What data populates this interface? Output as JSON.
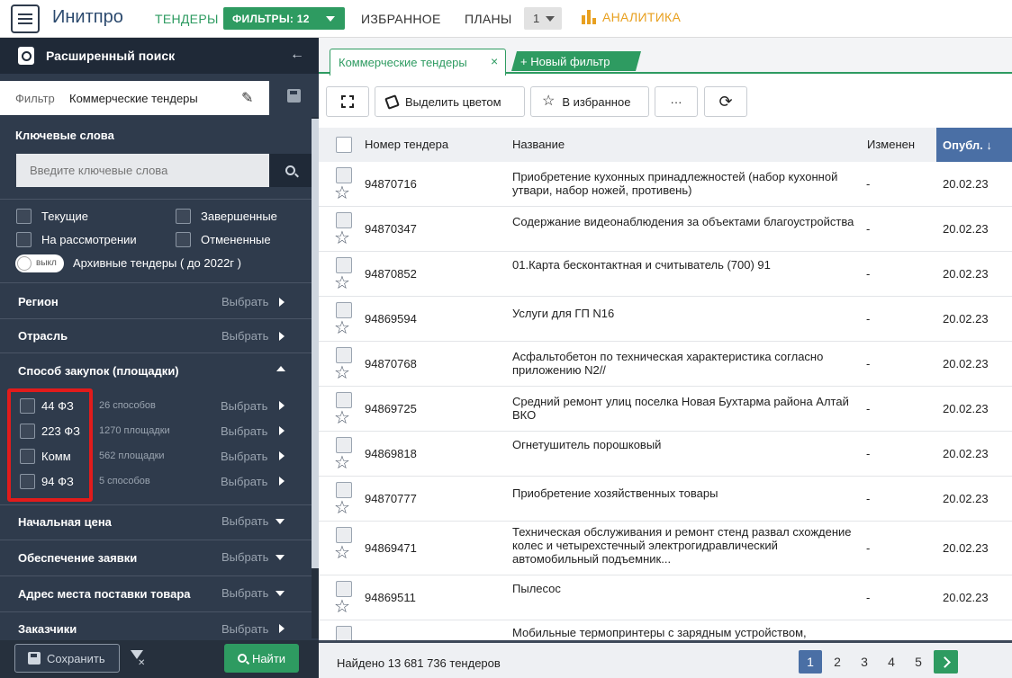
{
  "topbar": {
    "logo": "Инитпро",
    "tenders": "ТЕНДЕРЫ",
    "filters": "ФИЛЬТРЫ: 12",
    "favorites": "ИЗБРАННОЕ",
    "plans": "ПЛАНЫ",
    "plans_count": "1",
    "analytics": "АНАЛИТИКА",
    "accent_color": "#2e9b61",
    "analytics_color": "#e8a020"
  },
  "sidebar": {
    "title": "Расширенный поиск",
    "filter_label": "Фильтр",
    "filter_name": "Коммерческие тендеры",
    "keywords_label": "Ключевые слова",
    "keywords_placeholder": "Введите ключевые слова",
    "status": {
      "current": "Текущие",
      "finished": "Завершенные",
      "review": "На рассмотрении",
      "cancelled": "Отмененные"
    },
    "archive_toggle": "выкл",
    "archive_label": "Архивные тендеры ( до 2022г )",
    "choose": "Выбрать",
    "sections": {
      "region": "Регион",
      "industry": "Отрасль",
      "procurement": "Способ закупок (площадки)",
      "start_price": "Начальная цена",
      "security": "Обеспечение заявки",
      "address": "Адрес места поставки товара",
      "customers": "Заказчики"
    },
    "laws": [
      {
        "label": "44 ФЗ",
        "count": "26 способов"
      },
      {
        "label": "223 ФЗ",
        "count": "1270 площадки"
      },
      {
        "label": "Комм",
        "count": "562 площадки"
      },
      {
        "label": "94 ФЗ",
        "count": "5 способов"
      }
    ],
    "save": "Сохранить",
    "find": "Найти"
  },
  "tabs": {
    "active": "Коммерческие тендеры",
    "close": "×",
    "new": "+ Новый фильтр"
  },
  "toolbar": {
    "highlight": "Выделить цветом",
    "favorite": "В избранное",
    "more": "···"
  },
  "table": {
    "headers": {
      "number": "Номер тендера",
      "name": "Название",
      "changed": "Изменен",
      "published": "Опубл. ↓"
    },
    "rows": [
      {
        "num": "94870716",
        "name": "Приобретение кухонных принадлежностей (набор кухонной утвари, набор ножей, противень)",
        "changed": "-",
        "pub": "20.02.23"
      },
      {
        "num": "94870347",
        "name": "Содержание видеонаблюдения за объектами благоустройства",
        "changed": "-",
        "pub": "20.02.23"
      },
      {
        "num": "94870852",
        "name": "01.Карта бесконтактная и считыватель (700) 91",
        "changed": "-",
        "pub": "20.02.23"
      },
      {
        "num": "94869594",
        "name": "Услуги для ГП N16",
        "changed": "-",
        "pub": "20.02.23"
      },
      {
        "num": "94870768",
        "name": "Асфальтобетон по техническая характеристика согласно приложению N2//",
        "changed": "-",
        "pub": "20.02.23"
      },
      {
        "num": "94869725",
        "name": "Средний ремонт улиц поселка Новая Бухтарма района Алтай ВКО",
        "changed": "-",
        "pub": "20.02.23"
      },
      {
        "num": "94869818",
        "name": "Огнетушитель порошковый",
        "changed": "-",
        "pub": "20.02.23"
      },
      {
        "num": "94870777",
        "name": "Приобретение хозяйственных товары",
        "changed": "-",
        "pub": "20.02.23"
      },
      {
        "num": "94869471",
        "name": "Техническая обслуживания и ремонт стенд развал схождение колес и четырехстечный электрогидравлический автомобильный подъемник...",
        "changed": "-",
        "pub": "20.02.23"
      },
      {
        "num": "94869511",
        "name": "Пылесос",
        "changed": "-",
        "pub": "20.02.23"
      },
      {
        "num": "",
        "name": "Мобильные термопринтеры с зарядным устройством,",
        "changed": "",
        "pub": ""
      }
    ]
  },
  "footer": {
    "found": "Найдено 13 681 736 тендеров",
    "pages": [
      "1",
      "2",
      "3",
      "4",
      "5"
    ]
  }
}
